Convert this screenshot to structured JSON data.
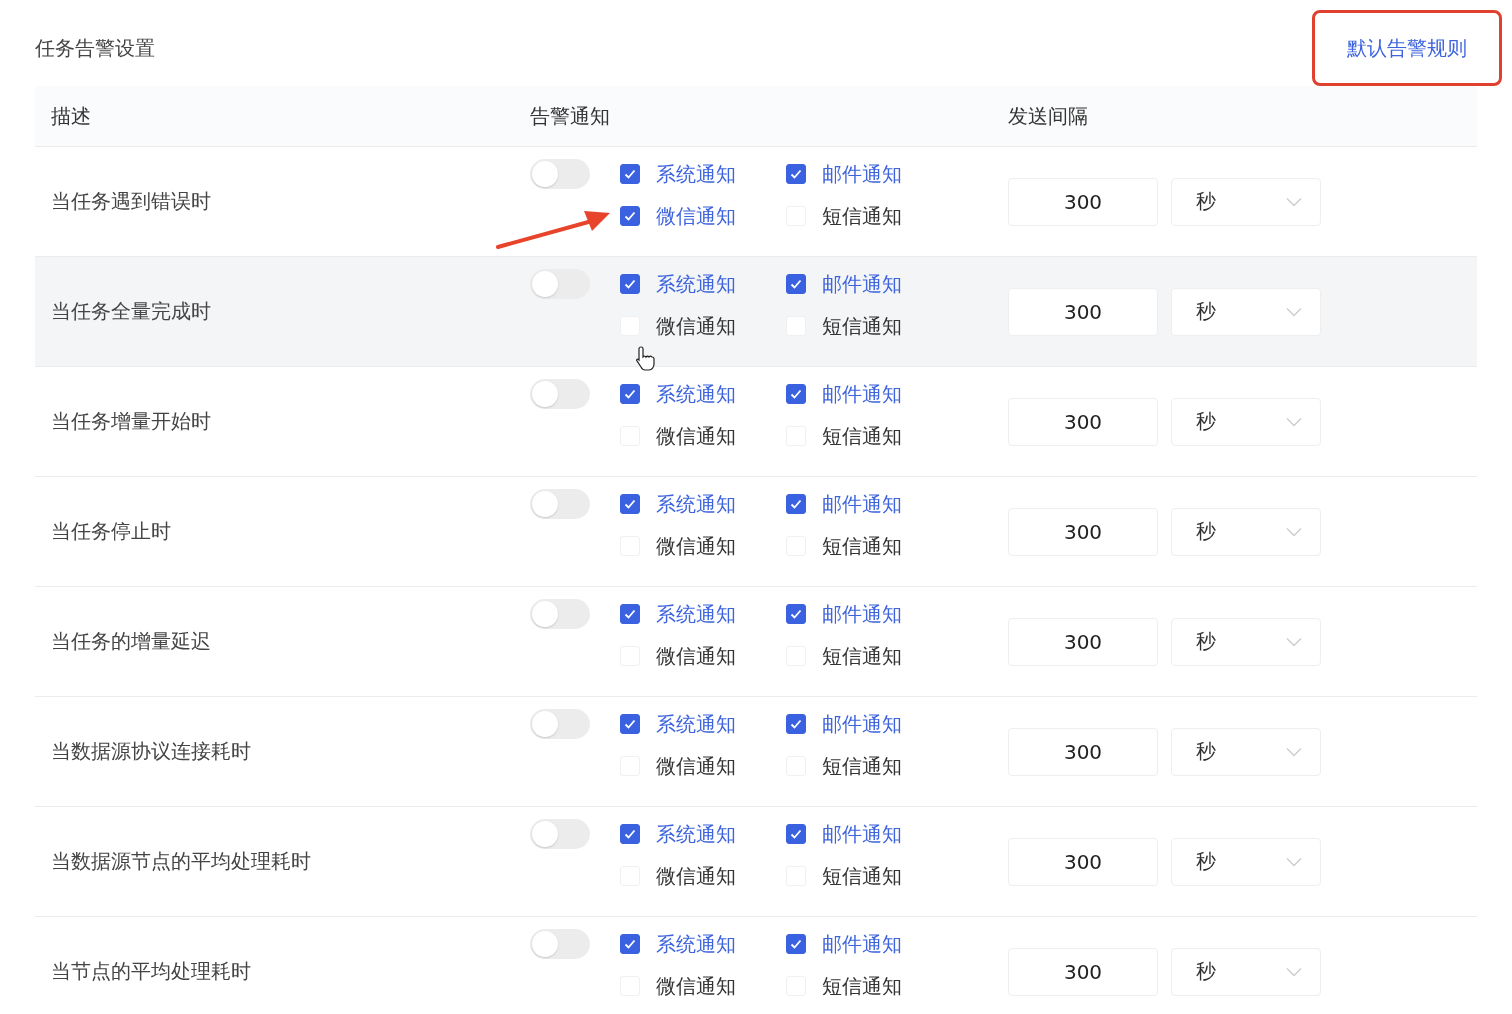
{
  "title": "任务告警设置",
  "default_rule_button": {
    "label": "默认告警规则",
    "highlighted": true
  },
  "table": {
    "columns": [
      "描述",
      "告警通知",
      "发送间隔"
    ],
    "rows": [
      {
        "description": "当任务遇到错误时",
        "on": false,
        "hovered": false,
        "annotated": true,
        "options": [
          {
            "label": "系统通知",
            "checked": true
          },
          {
            "label": "邮件通知",
            "checked": true
          },
          {
            "label": "微信通知",
            "checked": true
          },
          {
            "label": "短信通知",
            "checked": false
          }
        ],
        "interval": "300",
        "unit": "秒"
      },
      {
        "description": "当任务全量完成时",
        "on": false,
        "hovered": true,
        "annotated": false,
        "options": [
          {
            "label": "系统通知",
            "checked": true
          },
          {
            "label": "邮件通知",
            "checked": true
          },
          {
            "label": "微信通知",
            "checked": false
          },
          {
            "label": "短信通知",
            "checked": false
          }
        ],
        "interval": "300",
        "unit": "秒"
      },
      {
        "description": "当任务增量开始时",
        "on": false,
        "hovered": false,
        "annotated": false,
        "options": [
          {
            "label": "系统通知",
            "checked": true
          },
          {
            "label": "邮件通知",
            "checked": true
          },
          {
            "label": "微信通知",
            "checked": false
          },
          {
            "label": "短信通知",
            "checked": false
          }
        ],
        "interval": "300",
        "unit": "秒"
      },
      {
        "description": "当任务停止时",
        "on": false,
        "hovered": false,
        "annotated": false,
        "options": [
          {
            "label": "系统通知",
            "checked": true
          },
          {
            "label": "邮件通知",
            "checked": true
          },
          {
            "label": "微信通知",
            "checked": false
          },
          {
            "label": "短信通知",
            "checked": false
          }
        ],
        "interval": "300",
        "unit": "秒"
      },
      {
        "description": "当任务的增量延迟",
        "on": false,
        "hovered": false,
        "annotated": false,
        "options": [
          {
            "label": "系统通知",
            "checked": true
          },
          {
            "label": "邮件通知",
            "checked": true
          },
          {
            "label": "微信通知",
            "checked": false
          },
          {
            "label": "短信通知",
            "checked": false
          }
        ],
        "interval": "300",
        "unit": "秒"
      },
      {
        "description": "当数据源协议连接耗时",
        "on": false,
        "hovered": false,
        "annotated": false,
        "options": [
          {
            "label": "系统通知",
            "checked": true
          },
          {
            "label": "邮件通知",
            "checked": true
          },
          {
            "label": "微信通知",
            "checked": false
          },
          {
            "label": "短信通知",
            "checked": false
          }
        ],
        "interval": "300",
        "unit": "秒"
      },
      {
        "description": "当数据源节点的平均处理耗时",
        "on": false,
        "hovered": false,
        "annotated": false,
        "options": [
          {
            "label": "系统通知",
            "checked": true
          },
          {
            "label": "邮件通知",
            "checked": true
          },
          {
            "label": "微信通知",
            "checked": false
          },
          {
            "label": "短信通知",
            "checked": false
          }
        ],
        "interval": "300",
        "unit": "秒"
      },
      {
        "description": "当节点的平均处理耗时",
        "on": false,
        "hovered": false,
        "annotated": false,
        "options": [
          {
            "label": "系统通知",
            "checked": true
          },
          {
            "label": "邮件通知",
            "checked": true
          },
          {
            "label": "微信通知",
            "checked": false
          },
          {
            "label": "短信通知",
            "checked": false
          }
        ],
        "interval": "300",
        "unit": "秒"
      }
    ]
  }
}
